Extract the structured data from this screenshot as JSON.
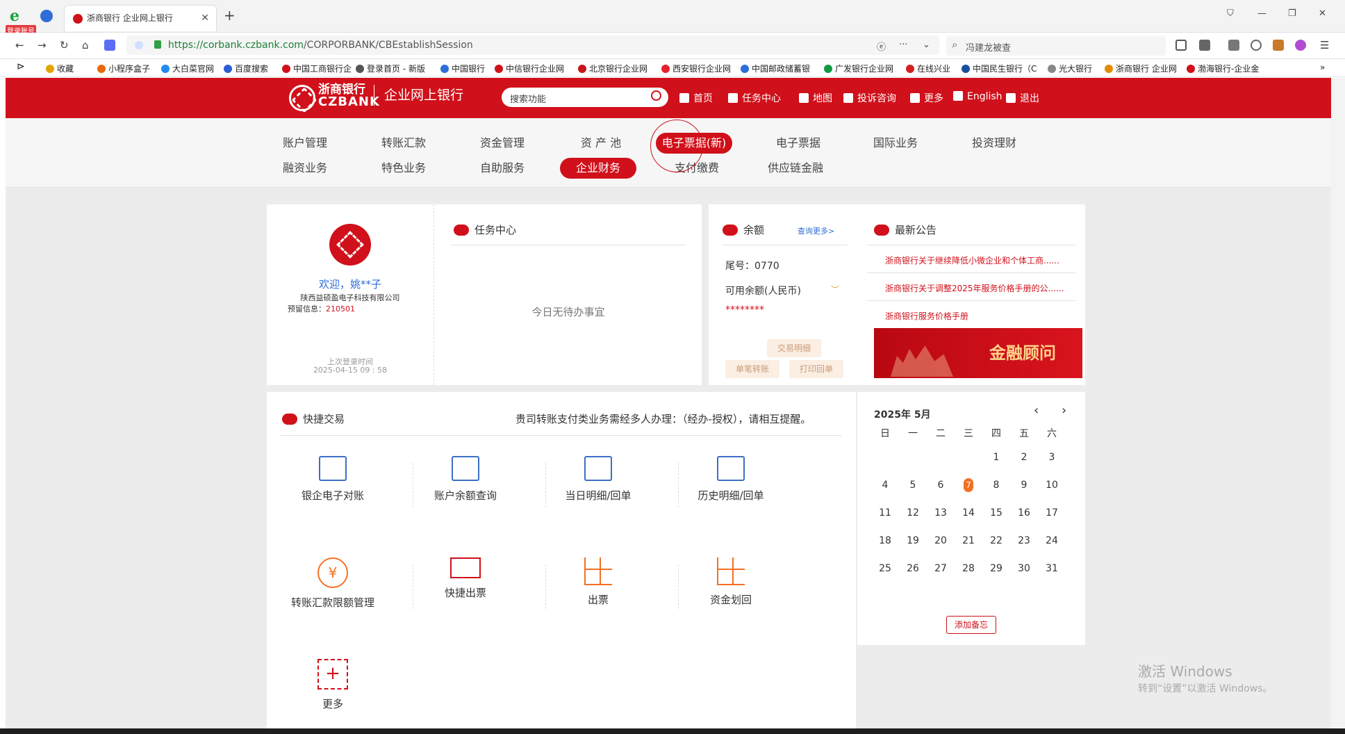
{
  "browser": {
    "profile_badge": "登录账号",
    "tab_title": "浙商银行 企业网上银行",
    "url_host": "https://corbank.czbank.com",
    "url_path": "/CORPORBANK/CBEstablishSession",
    "search_text": "冯建龙被查",
    "bookmarks": [
      "收藏",
      "小程序盒子",
      "大白菜官网",
      "百度搜索",
      "中国工商银行企",
      "登录首页 - 新版",
      "中国银行",
      "中信银行企业网",
      "北京银行企业网",
      "西安银行企业网",
      "中国邮政储蓄银",
      "广发银行企业网",
      "在线兴业",
      "中国民生银行（C",
      "光大银行",
      "浙商银行 企业网",
      "渤海银行-企业金"
    ]
  },
  "header": {
    "bank_cn": "浙商银行",
    "bank_en": "CZBANK",
    "subtitle": "企业网上银行",
    "search_placeholder": "搜索功能",
    "nav": [
      "首页",
      "任务中心",
      "地图",
      "投诉咨询",
      "更多",
      "English",
      "退出"
    ]
  },
  "menu": {
    "row1": [
      "账户管理",
      "转账汇款",
      "资金管理",
      "资 产 池",
      "电子票据(新)",
      "电子票据",
      "国际业务",
      "投资理财"
    ],
    "row2": [
      "融资业务",
      "特色业务",
      "自助服务",
      "企业财务",
      "支付缴费",
      "供应链金融"
    ]
  },
  "user": {
    "welcome": "欢迎，姚**子",
    "company": "陕西益硕盈电子科技有限公司",
    "reserved_label": "预留信息：",
    "reserved_value": "210501",
    "last_login_label": "上次登录时间",
    "last_login_time": "2025-04-15 09 : 58"
  },
  "tasks": {
    "title": "任务中心",
    "empty": "今日无待办事宜"
  },
  "balance": {
    "title": "余额",
    "more": "查询更多>",
    "tail": "尾号：0770",
    "available": "可用余额(人民币)",
    "masked": "********",
    "btn_detail": "交易明细",
    "btn_transfer": "单笔转账",
    "btn_print": "打印回单"
  },
  "notices": {
    "title": "最新公告",
    "items": [
      "浙商银行关于继续降低小微企业和个体工商......",
      "浙商银行关于调整2025年服务价格手册的公......",
      "浙商银行服务价格手册"
    ],
    "banner": "金融顾问"
  },
  "quick": {
    "title": "快捷交易",
    "tip": "贵司转账支付类业务需经多人办理：（经办-授权），请相互提醒。",
    "items": [
      "银企电子对账",
      "账户余额查询",
      "当日明细/回单",
      "历史明细/回单",
      "转账汇款限额管理",
      "快捷出票",
      "出票",
      "资金划回",
      "更多"
    ]
  },
  "calendar": {
    "month": "2025年 5月",
    "weekdays": [
      "日",
      "一",
      "二",
      "三",
      "四",
      "五",
      "六"
    ],
    "add_memo": "添加备忘"
  },
  "windows": {
    "line1": "激活 Windows",
    "line2": "转到“设置”以激活 Windows。"
  }
}
